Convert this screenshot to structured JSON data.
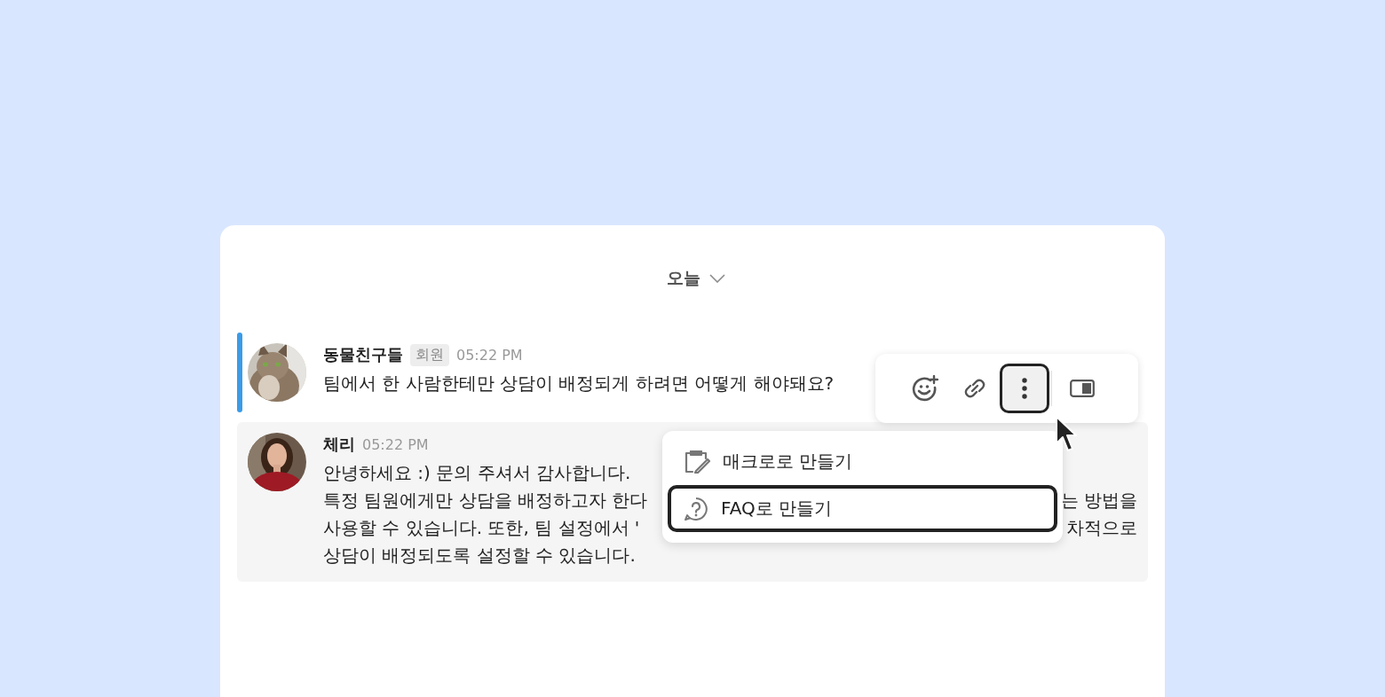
{
  "date_header": {
    "label": "오늘"
  },
  "messages": [
    {
      "kind": "question",
      "author": "동물친구들",
      "badge": "회원",
      "time": "05:22 PM",
      "highlighted": true,
      "hovered": false,
      "avatar": {
        "kind": "picture"
      },
      "lines": [
        {
          "left": "팀에서 한 사람한테만 상담이 배정되게 하려면 어떻게 해야돼요?"
        }
      ]
    },
    {
      "kind": "answer",
      "author": "체리",
      "time": "05:22 PM",
      "highlighted": false,
      "hovered": true,
      "avatar": {
        "kind": "picture"
      },
      "lines": [
        {
          "left": "안녕하세요 :) 문의 주셔서 감사합니다."
        },
        {
          "left": "특정 팀원에게만 상담을 배정하고자 한다",
          "right": "는 방법을"
        },
        {
          "left": "사용할 수 있습니다. 또한, 팀 설정에서 '",
          "right": "차적으로"
        },
        {
          "left": "상담이 배정되도록 설정할 수 있습니다."
        }
      ]
    }
  ],
  "toolbar": {
    "buttons": [
      {
        "kind": "emoji_add",
        "selected": false
      },
      {
        "kind": "link",
        "selected": false
      },
      {
        "kind": "more",
        "selected": true
      },
      {
        "kind": "panel",
        "selected": false
      }
    ]
  },
  "menu": {
    "items": [
      {
        "kind": "macro",
        "label": "매크로로 만들기",
        "selected": false
      },
      {
        "kind": "faq",
        "label": "FAQ로 만들기",
        "selected": true
      }
    ]
  }
}
